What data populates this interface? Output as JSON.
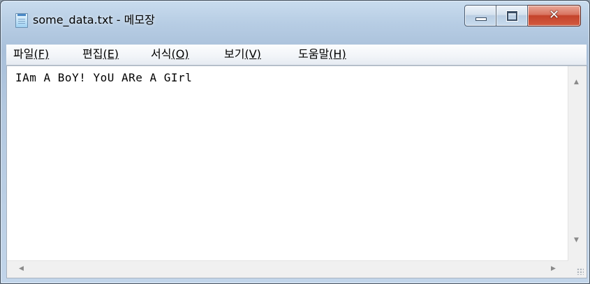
{
  "window": {
    "title": "some_data.txt - 메모장"
  },
  "menu": {
    "items": [
      {
        "label": "파일",
        "mnemonic": "(F)"
      },
      {
        "label": "편집",
        "mnemonic": "(E)"
      },
      {
        "label": "서식",
        "mnemonic": "(O)"
      },
      {
        "label": "보기",
        "mnemonic": "(V)"
      },
      {
        "label": "도움말",
        "mnemonic": "(H)"
      }
    ]
  },
  "editor": {
    "text": "IAm A BoY! YoU ARe A GIrl"
  },
  "icons": {
    "app": "notepad-icon",
    "minimize": "minimize-icon",
    "maximize": "maximize-icon",
    "close": "close-icon",
    "scroll_up": "scroll-up-arrow-icon",
    "scroll_down": "scroll-down-arrow-icon",
    "scroll_left": "scroll-left-arrow-icon",
    "scroll_right": "scroll-right-arrow-icon",
    "resize": "resize-grip-icon"
  },
  "colors": {
    "titlebar": "#b7cde4",
    "close_button": "#c4432b"
  }
}
